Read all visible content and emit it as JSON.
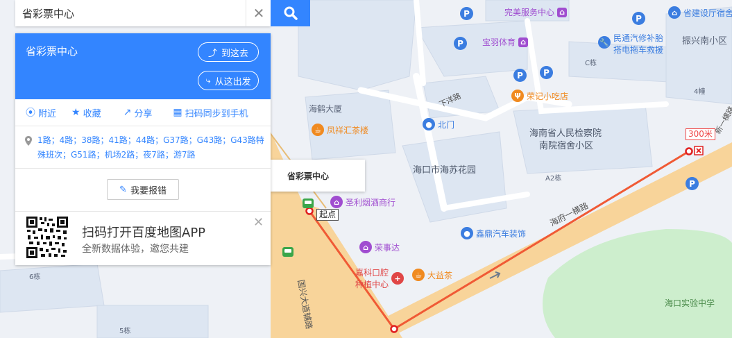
{
  "search": {
    "value": "省彩票中心"
  },
  "card": {
    "title": "省彩票中心",
    "go_here": "到这去",
    "start_here": "从这出发",
    "actions": [
      {
        "label": "附近",
        "icon": "location-icon"
      },
      {
        "label": "收藏",
        "icon": "star-icon"
      },
      {
        "label": "分享",
        "icon": "share-icon"
      },
      {
        "label": "扫码同步到手机",
        "icon": "qr-scan-icon"
      }
    ],
    "bus_lines": "1路；4路；38路；41路；44路；G37路；G43路；G43路特殊班次；G51路；机场2路；夜7路；游7路",
    "report": "我要报错",
    "app_title": "扫码打开百度地图APP",
    "app_subtitle": "全新数据体验，邀您共建"
  },
  "map": {
    "callout": "省彩票中心",
    "start_tag": "起点",
    "distance_tag": "300米",
    "road_labels": [
      {
        "text": "海府一横路"
      },
      {
        "text": "国兴大道辅路"
      },
      {
        "text": "下洋路"
      },
      {
        "text": "新一横路"
      }
    ],
    "area_labels": [
      {
        "text": "海南省人民检察院"
      },
      {
        "text": "南院宿舍小区"
      },
      {
        "text": "海口市海苏花园"
      },
      {
        "text": "海口实验中学"
      },
      {
        "text": "海鹤大厦"
      },
      {
        "text": "振兴南小区"
      },
      {
        "text": "C栋"
      },
      {
        "text": "A2栋"
      },
      {
        "text": "4幢"
      },
      {
        "text": "6栋"
      },
      {
        "text": "5栋"
      }
    ],
    "pois": [
      {
        "text": "完美服务中心",
        "color": "#a04dd0"
      },
      {
        "text": "宝羽体育",
        "color": "#a04dd0"
      },
      {
        "text": "民通汽修补胎",
        "color": "#3b7de0"
      },
      {
        "text": "搭电拖车救援",
        "color": "#3b7de0"
      },
      {
        "text": "省建设厅宿舍",
        "color": "#3b7de0"
      },
      {
        "text": "荣记小吃店",
        "color": "#f08a20"
      },
      {
        "text": "北门",
        "color": "#3b7de0"
      },
      {
        "text": "凤祥汇茶楼",
        "color": "#f08a20"
      },
      {
        "text": "圣利烟酒商行",
        "color": "#a04dd0"
      },
      {
        "text": "鑫鼎汽车装饰",
        "color": "#3b7de0"
      },
      {
        "text": "荣事达",
        "color": "#a04dd0"
      },
      {
        "text": "嘉科口腔",
        "color": "#e04646"
      },
      {
        "text": "种植中心",
        "color": "#e04646"
      },
      {
        "text": "大益茶",
        "color": "#f08a20"
      }
    ],
    "route_color": "#f05a35"
  }
}
